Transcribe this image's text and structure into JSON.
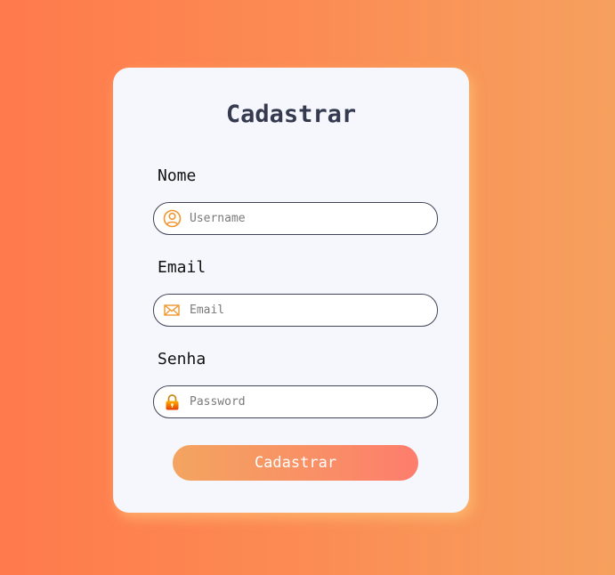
{
  "form": {
    "title": "Cadastrar",
    "fields": [
      {
        "label": "Nome",
        "placeholder": "Username",
        "value": "",
        "icon": "user-circle-icon"
      },
      {
        "label": "Email",
        "placeholder": "Email",
        "value": "",
        "icon": "envelope-icon"
      },
      {
        "label": "Senha",
        "placeholder": "Password",
        "value": "",
        "icon": "lock-icon"
      }
    ],
    "submit_label": "Cadastrar"
  },
  "colors": {
    "background_gradient": [
      "#ff7a4d",
      "#f6a05e"
    ],
    "card": "#f6f7fc",
    "title": "#353a4f",
    "icon_accent": "#f0962f",
    "button_gradient": [
      "#f4a460",
      "#fd7d6c"
    ]
  }
}
